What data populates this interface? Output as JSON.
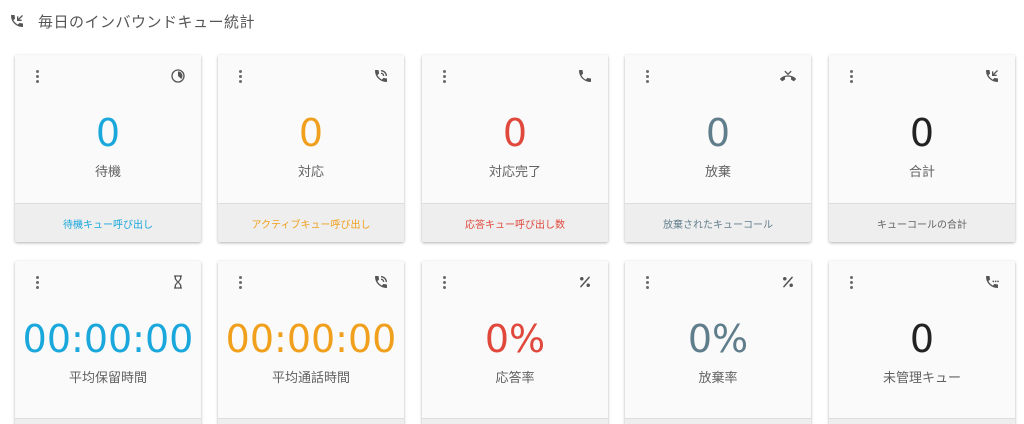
{
  "header": {
    "title": "毎日のインバウンドキュー統計",
    "icon": "callback-icon"
  },
  "colors": {
    "blue": "#1aa7dc",
    "orange": "#f0a01c",
    "red": "#e0483c",
    "slate": "#607d8b",
    "dark": "#222222"
  },
  "cards_row1": [
    {
      "value": "0",
      "label": "待機",
      "footer": "待機キュー呼び出し",
      "icon": "pie-chart-icon"
    },
    {
      "value": "0",
      "label": "対応",
      "footer": "アクティブキュー呼び出し",
      "icon": "phone-in-talk-icon"
    },
    {
      "value": "0",
      "label": "対応完了",
      "footer": "応答キュー呼び出し数",
      "icon": "phone-icon"
    },
    {
      "value": "0",
      "label": "放棄",
      "footer": "放棄されたキューコール",
      "icon": "call-end-icon"
    },
    {
      "value": "0",
      "label": "合計",
      "footer": "キューコールの合計",
      "icon": "phone-callback-icon"
    }
  ],
  "cards_row2": [
    {
      "value": "00:00:00",
      "label": "平均保留時間",
      "icon": "hourglass-icon"
    },
    {
      "value": "00:00:00",
      "label": "平均通話時間",
      "icon": "phone-in-talk-icon"
    },
    {
      "value": "0%",
      "label": "応答率",
      "icon": "percent-icon"
    },
    {
      "value": "0%",
      "label": "放棄率",
      "icon": "percent-icon"
    },
    {
      "value": "0",
      "label": "未管理キュー",
      "icon": "phone-missed-icon"
    }
  ]
}
